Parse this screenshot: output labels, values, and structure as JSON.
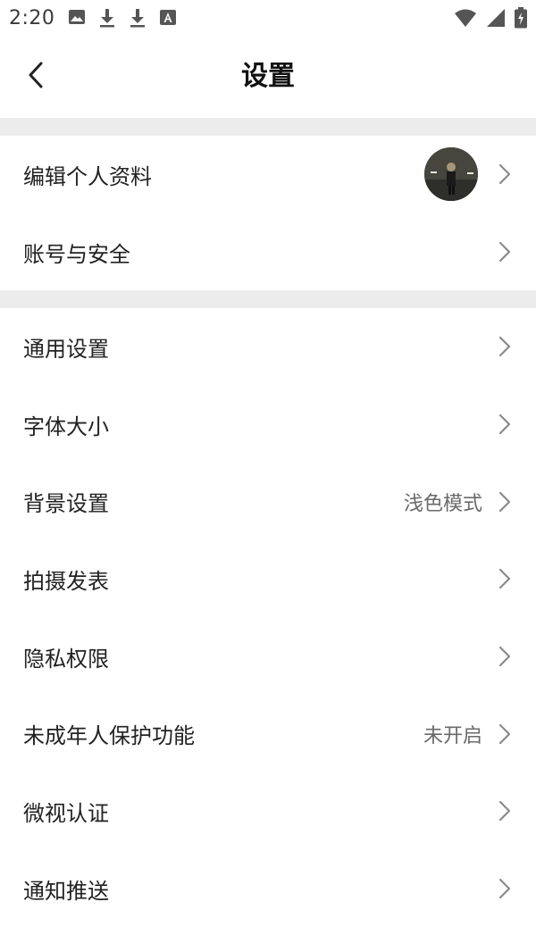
{
  "status_bar": {
    "time": "2:20",
    "left_icons": [
      "image-icon",
      "download-icon",
      "download-icon",
      "a-icon"
    ],
    "right_icons": [
      "wifi-icon",
      "signal-icon",
      "battery-icon"
    ]
  },
  "header": {
    "title": "设置",
    "back_icon": "chevron-left-icon"
  },
  "sections": [
    {
      "items": [
        {
          "label": "编辑个人资料",
          "value": "",
          "has_avatar": true
        },
        {
          "label": "账号与安全",
          "value": ""
        }
      ]
    },
    {
      "items": [
        {
          "label": "通用设置",
          "value": ""
        },
        {
          "label": "字体大小",
          "value": ""
        },
        {
          "label": "背景设置",
          "value": "浅色模式"
        },
        {
          "label": "拍摄发表",
          "value": ""
        },
        {
          "label": "隐私权限",
          "value": ""
        },
        {
          "label": "未成年人保护功能",
          "value": "未开启"
        },
        {
          "label": "微视认证",
          "value": ""
        },
        {
          "label": "通知推送",
          "value": ""
        }
      ]
    }
  ],
  "colors": {
    "background": "#ffffff",
    "divider": "#ececec",
    "text_primary": "#222222",
    "text_secondary": "#6a6a6a",
    "chevron": "#8a8a8a"
  }
}
